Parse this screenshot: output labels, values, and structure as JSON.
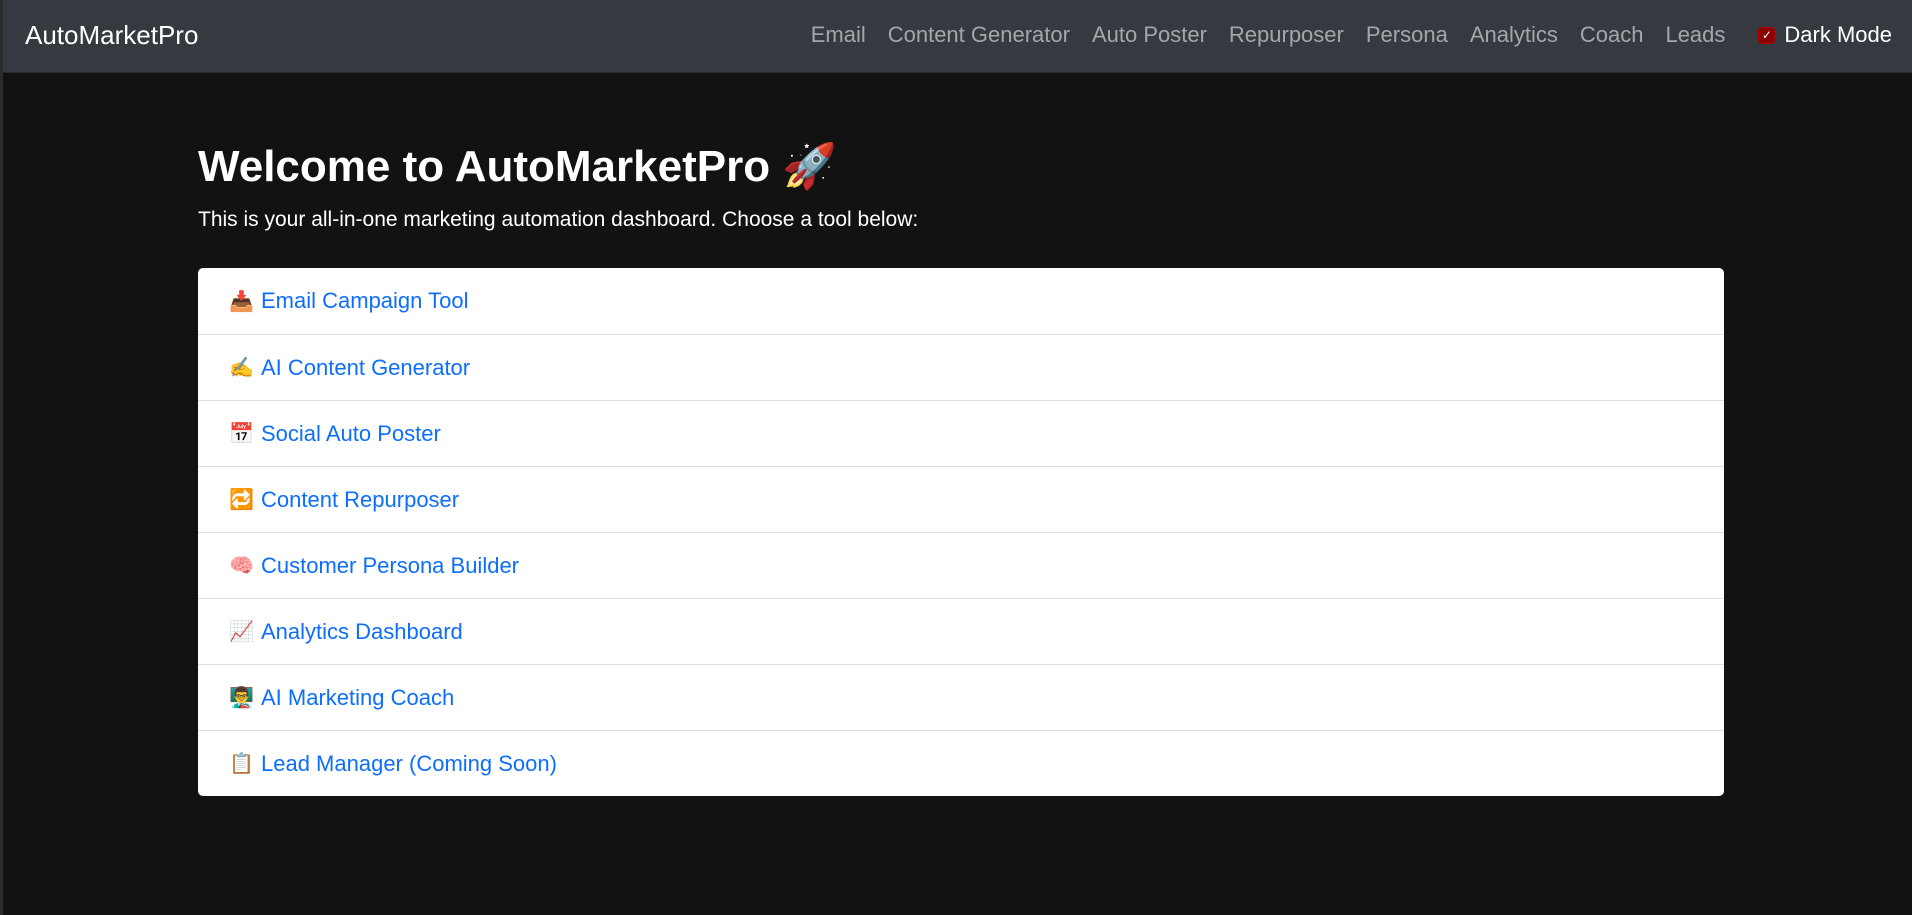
{
  "navbar": {
    "brand": "AutoMarketPro",
    "links": [
      {
        "label": "Email"
      },
      {
        "label": "Content Generator"
      },
      {
        "label": "Auto Poster"
      },
      {
        "label": "Repurposer"
      },
      {
        "label": "Persona"
      },
      {
        "label": "Analytics"
      },
      {
        "label": "Coach"
      },
      {
        "label": "Leads"
      }
    ],
    "dark_mode": {
      "label": "Dark Mode",
      "checked": true,
      "checkmark": "✓"
    }
  },
  "main": {
    "title": "Welcome to AutoMarketPro",
    "title_icon": "🚀",
    "title_icon_name": "rocket-icon",
    "subtitle": "This is your all-in-one marketing automation dashboard. Choose a tool below:",
    "tools": [
      {
        "icon": "📥",
        "icon_name": "inbox-tray-icon",
        "label": "Email Campaign Tool"
      },
      {
        "icon": "✍️",
        "icon_name": "writing-hand-icon",
        "label": "AI Content Generator"
      },
      {
        "icon": "📅",
        "icon_name": "calendar-icon",
        "label": "Social Auto Poster"
      },
      {
        "icon": "🔁",
        "icon_name": "repeat-icon",
        "label": "Content Repurposer"
      },
      {
        "icon": "🧠",
        "icon_name": "brain-icon",
        "label": "Customer Persona Builder"
      },
      {
        "icon": "📈",
        "icon_name": "chart-increasing-icon",
        "label": "Analytics Dashboard"
      },
      {
        "icon": "👨‍🏫",
        "icon_name": "teacher-icon",
        "label": "AI Marketing Coach"
      },
      {
        "icon": "📋",
        "icon_name": "clipboard-icon",
        "label": "Lead Manager (Coming Soon)"
      }
    ]
  },
  "colors": {
    "navbar_bg": "#343a40",
    "page_bg": "#121212",
    "link_blue": "#0d6efd",
    "checkbox": "#8b0000"
  }
}
